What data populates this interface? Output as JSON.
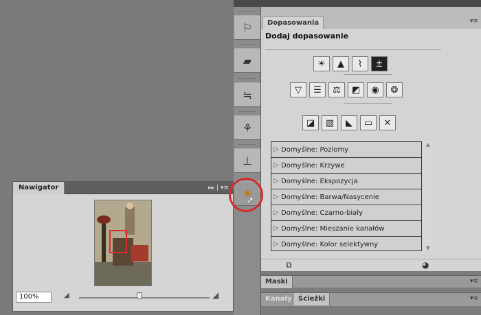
{
  "navigator": {
    "tab_label": "Nawigator",
    "menu_glyph": "▸▸ | ▾≡",
    "zoom_value": "100%"
  },
  "adjustments": {
    "tab_label": "Dopasowania",
    "title": "Dodaj dopasowanie",
    "presets": [
      "Domyślne: Poziomy",
      "Domyślne: Krzywe",
      "Domyślne: Ekspozycja",
      "Domyślne: Barwa/Nasycenie",
      "Domyślne: Czarno-biały",
      "Domyślne: Mieszanie kanałów",
      "Domyślne: Kolor selektywny"
    ]
  },
  "collapsed_panels": {
    "masks_tab": "Maski",
    "channels_tab": "Kanały",
    "paths_tab": "Ścieżki"
  },
  "colors": {
    "highlight": "#d42e2e"
  }
}
